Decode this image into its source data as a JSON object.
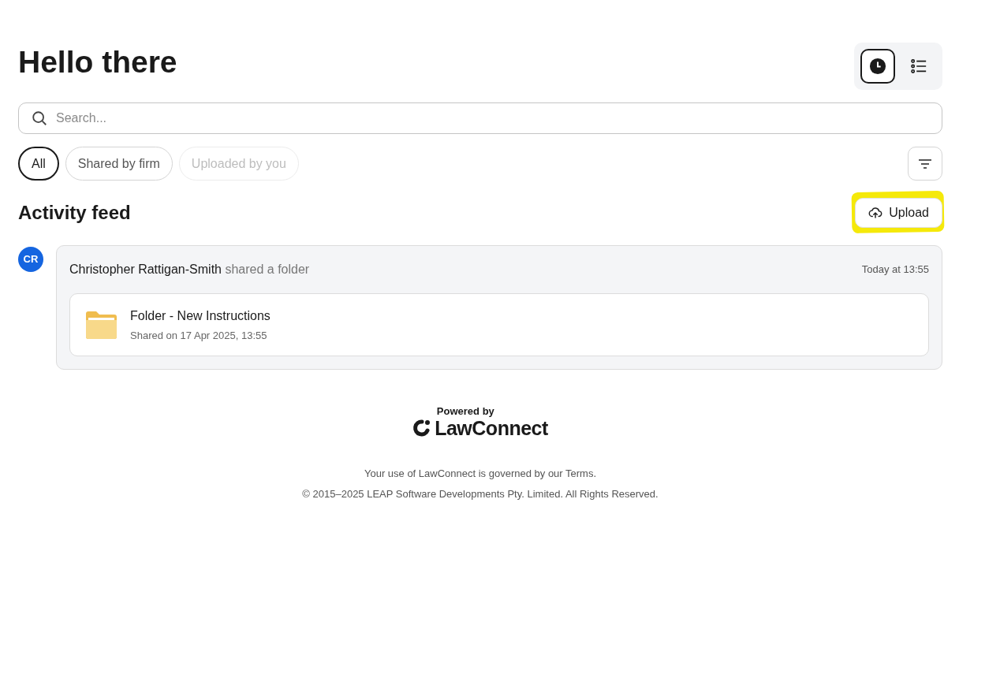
{
  "heading": "Hello there",
  "view_toggles": [
    {
      "kind": "clock",
      "selected": true
    },
    {
      "kind": "list",
      "selected": false
    }
  ],
  "search": {
    "placeholder": "Search..."
  },
  "filters": [
    {
      "label": "All",
      "selected": true,
      "disabled": false
    },
    {
      "label": "Shared by firm",
      "selected": false,
      "disabled": false
    },
    {
      "label": "Uploaded by you",
      "selected": false,
      "disabled": true
    }
  ],
  "section_title": "Activity feed",
  "upload_button": {
    "label": "Upload",
    "highlighted": true
  },
  "activity": [
    {
      "initials": "CR",
      "color": "#1565e0",
      "actor": "Christopher Rattigan-Smith",
      "action": "shared a folder",
      "time": "Today at 13:55",
      "item": {
        "name": "Folder - New Instructions",
        "meta": "Shared on 17 Apr 2025, 13:55"
      }
    }
  ],
  "footer": {
    "powered_by": "Powered by",
    "brand": "LawConnect",
    "terms": "Your use of LawConnect is governed by our Terms.",
    "copyright": "© 2015–2025 LEAP Software Developments Pty. Limited. All Rights Reserved."
  }
}
